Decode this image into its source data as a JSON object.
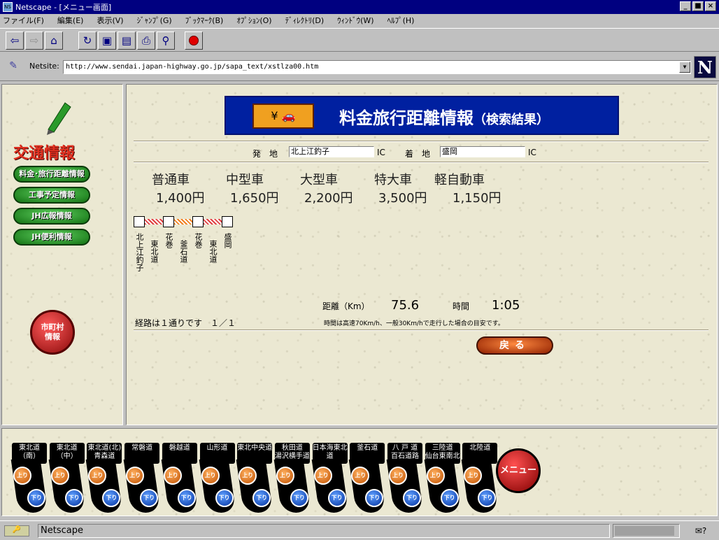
{
  "window": {
    "title": "Netscape - [メニュー画面]",
    "minimize": "_",
    "maximize": "■",
    "close": "×"
  },
  "menubar": [
    "ファイル(F)",
    "編集(E)",
    "表示(V)",
    "ｼﾞｬﾝﾌﾟ(G)",
    "ﾌﾞｯｸﾏｰｸ(B)",
    "ｵﾌﾟｼｮﾝ(O)",
    "ﾃﾞｨﾚｸﾄﾘ(D)",
    "ｳｨﾝﾄﾞｳ(W)",
    "ﾍﾙﾌﾟ(H)"
  ],
  "toolbar": {
    "icons": [
      "back-icon",
      "forward-icon",
      "home-icon",
      "reload-icon",
      "images-icon",
      "open-icon",
      "print-icon",
      "find-icon",
      "stop-icon"
    ]
  },
  "location": {
    "label": "Netsite:",
    "url": "http://www.sendai.japan-highway.go.jp/sapa_text/xstlza00.htm"
  },
  "left_nav": {
    "title": "交通情報",
    "buttons": [
      "料金･旅行距離情報",
      "工事予定情報",
      "JH広報情報",
      "JH便利情報"
    ],
    "city_button": "市町村情報"
  },
  "banner": {
    "title": "料金旅行距離情報",
    "subtitle": "（検索結果）"
  },
  "search": {
    "from_label": "発　地",
    "from_value": "北上江釣子",
    "from_suffix": "IC",
    "to_label": "着　地",
    "to_value": "盛岡",
    "to_suffix": "IC"
  },
  "fares": [
    {
      "vehicle": "普通車",
      "fare": "1,400円"
    },
    {
      "vehicle": "中型車",
      "fare": "1,650円"
    },
    {
      "vehicle": "大型車",
      "fare": "2,200円"
    },
    {
      "vehicle": "特大車",
      "fare": "3,500円"
    },
    {
      "vehicle": "軽自動車",
      "fare": "1,150円"
    }
  ],
  "route": {
    "labels": [
      "北上江釣子",
      "東北道",
      "花巻",
      "釜石道",
      "花巻",
      "東北道",
      "盛岡"
    ],
    "count_text": "経路は１通りです　１／１"
  },
  "summary": {
    "distance_label": "距離（Km）",
    "distance_value": "75.6",
    "time_label": "時間",
    "time_value": "1:05",
    "note": "時間は高速70Km/h、一般30Km/hで走行した場合の目安です。"
  },
  "back_button": "戻る",
  "roads": [
    {
      "name": "東北道\n（南）",
      "up": "上り",
      "down": "下り"
    },
    {
      "name": "東北道\n（中）",
      "up": "上り",
      "down": "下り"
    },
    {
      "name": "東北道(北)\n青森道",
      "up": "上り",
      "down": "下り"
    },
    {
      "name": "常磐道",
      "up": "上り",
      "down": "下り"
    },
    {
      "name": "磐越道",
      "up": "上り",
      "down": "下り"
    },
    {
      "name": "山形道",
      "up": "上り",
      "down": "下り"
    },
    {
      "name": "東北中央道",
      "up": "上り",
      "down": "下り"
    },
    {
      "name": "秋田道\n湯沢横手道",
      "up": "上り",
      "down": "下り"
    },
    {
      "name": "日本海東北道",
      "up": "上り",
      "down": "下り"
    },
    {
      "name": "釜石道",
      "up": "上り",
      "down": "下り"
    },
    {
      "name": "八 戸 道\n百石道路",
      "up": "上り",
      "down": "下り"
    },
    {
      "name": "三陸道\n仙台東南北",
      "up": "上り",
      "down": "下り"
    },
    {
      "name": "北陸道",
      "up": "上り",
      "down": "下り"
    }
  ],
  "menu_button": "メニュー",
  "status": {
    "text": "Netscape",
    "progress": 0.92
  }
}
